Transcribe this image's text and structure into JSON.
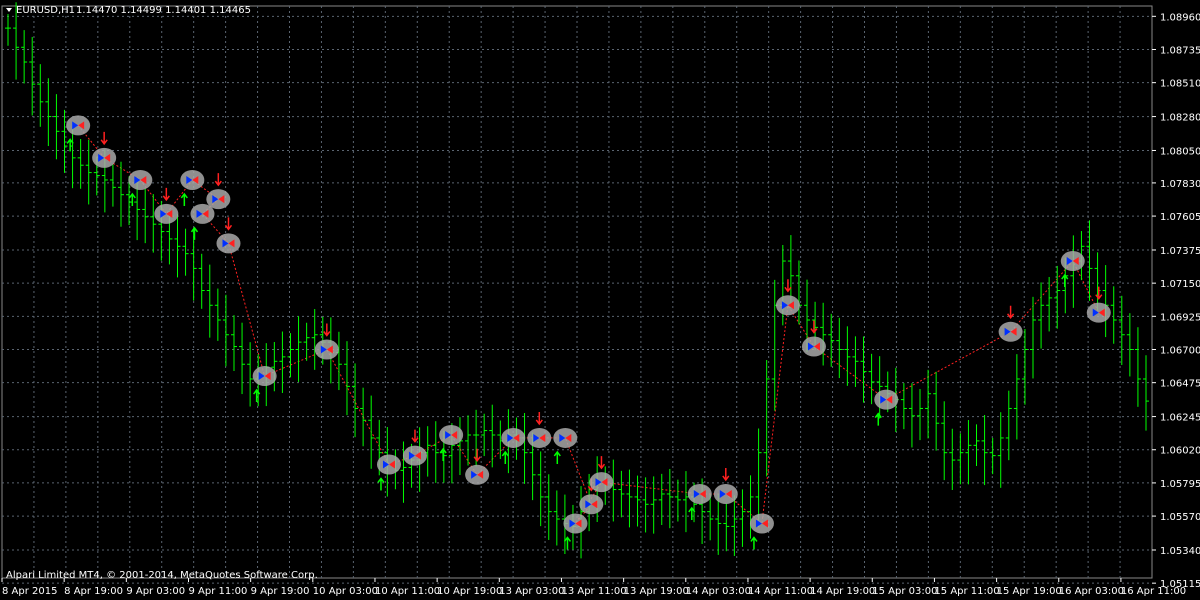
{
  "window": {
    "symbol_label": "EURUSD,H1",
    "ohlc_text": "1.14470 1.14499 1.14401 1.14465",
    "copyright": "Alpari Limited MT4, © 2001-2014, MetaQuotes Software Corp."
  },
  "colors": {
    "background": "#000000",
    "grid": "#5a6470",
    "bar": "#00ff00",
    "text": "#ffffff",
    "down_arrow": "#ff2020",
    "up_arrow": "#00ff00",
    "bubble": "#a8a8a8",
    "trend_line": "#ff2020"
  },
  "chart_data": {
    "type": "ohlc",
    "title": "",
    "xlabel": "",
    "ylabel": "",
    "ylim": [
      1.0515,
      1.0903
    ],
    "grid": true,
    "price_levels": [
      "1.08960",
      "1.08735",
      "1.08510",
      "1.08280",
      "1.08050",
      "1.07830",
      "1.07605",
      "1.07375",
      "1.07150",
      "1.06925",
      "1.06700",
      "1.06475",
      "1.06245",
      "1.06020",
      "1.05795",
      "1.05570",
      "1.05340",
      "1.05115"
    ],
    "x_labels": [
      "8 Apr 2015",
      "8 Apr 19:00",
      "9 Apr 03:00",
      "9 Apr 11:00",
      "9 Apr 19:00",
      "10 Apr 03:00",
      "10 Apr 11:00",
      "10 Apr 19:00",
      "13 Apr 03:00",
      "13 Apr 11:00",
      "13 Apr 19:00",
      "14 Apr 03:00",
      "14 Apr 11:00",
      "14 Apr 19:00",
      "15 Apr 03:00",
      "15 Apr 11:00",
      "15 Apr 19:00",
      "16 Apr 03:00",
      "16 Apr 11:00"
    ],
    "close_path": [
      1.0888,
      1.0875,
      1.0865,
      1.085,
      1.0838,
      1.0828,
      1.0818,
      1.0808,
      1.08,
      1.0795,
      1.079,
      1.0788,
      1.0785,
      1.078,
      1.0775,
      1.077,
      1.0765,
      1.076,
      1.0755,
      1.075,
      1.0745,
      1.074,
      1.0735,
      1.0725,
      1.071,
      1.07,
      1.069,
      1.068,
      1.0672,
      1.066,
      1.065,
      1.0652,
      1.0658,
      1.0662,
      1.0665,
      1.067,
      1.0675,
      1.0678,
      1.068,
      1.0675,
      1.0668,
      1.066,
      1.0645,
      1.063,
      1.0622,
      1.061,
      1.06,
      1.0592,
      1.0588,
      1.059,
      1.0595,
      1.06,
      1.0605,
      1.06,
      1.0598,
      1.0605,
      1.0608,
      1.0612,
      1.0612,
      1.0615,
      1.0612,
      1.0608,
      1.0612,
      1.061,
      1.06,
      1.0585,
      1.057,
      1.056,
      1.0555,
      1.0552,
      1.055,
      1.056,
      1.0575,
      1.058,
      1.0578,
      1.0575,
      1.0572,
      1.057,
      1.0568,
      1.0565,
      1.0568,
      1.0572,
      1.057,
      1.0568,
      1.057,
      1.0565,
      1.056,
      1.0555,
      1.0552,
      1.055,
      1.0555,
      1.056,
      1.057,
      1.06,
      1.065,
      1.07,
      1.073,
      1.072,
      1.07,
      1.069,
      1.0685,
      1.068,
      1.0676,
      1.067,
      1.0665,
      1.0662,
      1.0655,
      1.0648,
      1.0645,
      1.064,
      1.0636,
      1.063,
      1.0625,
      1.063,
      1.064,
      1.062,
      1.06,
      1.0595,
      1.06,
      1.0605,
      1.0608,
      1.06,
      1.0598,
      1.061,
      1.063,
      1.065,
      1.067,
      1.069,
      1.07,
      1.0705,
      1.071,
      1.072,
      1.073,
      1.074,
      1.0725,
      1.071,
      1.07,
      1.069,
      1.068,
      1.067,
      1.065,
      1.0635
    ],
    "bubbles": [
      {
        "date": "8 Apr 19:00",
        "price": 1.0822,
        "marker": "buy"
      },
      {
        "date": "8 Apr 19:00",
        "price": 1.08,
        "marker": "sell"
      },
      {
        "date": "9 Apr 03:00",
        "price": 1.0785,
        "marker": "buy"
      },
      {
        "date": "9 Apr 03:00",
        "price": 1.0762,
        "marker": "sell"
      },
      {
        "date": "9 Apr 03:00",
        "price": 1.0785,
        "marker": "buy"
      },
      {
        "date": "9 Apr 03:00",
        "price": 1.0772,
        "marker": "sell"
      },
      {
        "date": "9 Apr 11:00",
        "price": 1.0762,
        "marker": "buy"
      },
      {
        "date": "9 Apr 11:00",
        "price": 1.0742,
        "marker": "sell"
      },
      {
        "date": "9 Apr 19:00",
        "price": 1.0652,
        "marker": "buy"
      },
      {
        "date": "10 Apr 03:00",
        "price": 1.067,
        "marker": "sell"
      },
      {
        "date": "10 Apr 11:00",
        "price": 1.0592,
        "marker": "buy"
      },
      {
        "date": "10 Apr 11:00",
        "price": 1.0598,
        "marker": "sell"
      },
      {
        "date": "10 Apr 19:00",
        "price": 1.0612,
        "marker": "buy"
      },
      {
        "date": "10 Apr 19:00",
        "price": 1.0585,
        "marker": "sell"
      },
      {
        "date": "13 Apr 03:00",
        "price": 1.061,
        "marker": "buy"
      },
      {
        "date": "13 Apr 03:00",
        "price": 1.061,
        "marker": "sell"
      },
      {
        "date": "13 Apr 03:00",
        "price": 1.061,
        "marker": "buy"
      },
      {
        "date": "13 Apr 03:00",
        "price": 1.0565,
        "marker": "sell"
      },
      {
        "date": "13 Apr 11:00",
        "price": 1.0552,
        "marker": "buy"
      },
      {
        "date": "13 Apr 11:00",
        "price": 1.058,
        "marker": "sell"
      },
      {
        "date": "14 Apr 03:00",
        "price": 1.0572,
        "marker": "buy"
      },
      {
        "date": "14 Apr 03:00",
        "price": 1.0572,
        "marker": "sell"
      },
      {
        "date": "14 Apr 11:00",
        "price": 1.0552,
        "marker": "buy"
      },
      {
        "date": "14 Apr 11:00",
        "price": 1.07,
        "marker": "sell"
      },
      {
        "date": "14 Apr 11:00",
        "price": 1.0672,
        "marker": "sell"
      },
      {
        "date": "15 Apr 03:00",
        "price": 1.0636,
        "marker": "buy"
      },
      {
        "date": "15 Apr 19:00",
        "price": 1.0682,
        "marker": "sell"
      },
      {
        "date": "16 Apr 03:00",
        "price": 1.073,
        "marker": "buy"
      },
      {
        "date": "16 Apr 03:00",
        "price": 1.0695,
        "marker": "sell"
      }
    ]
  }
}
